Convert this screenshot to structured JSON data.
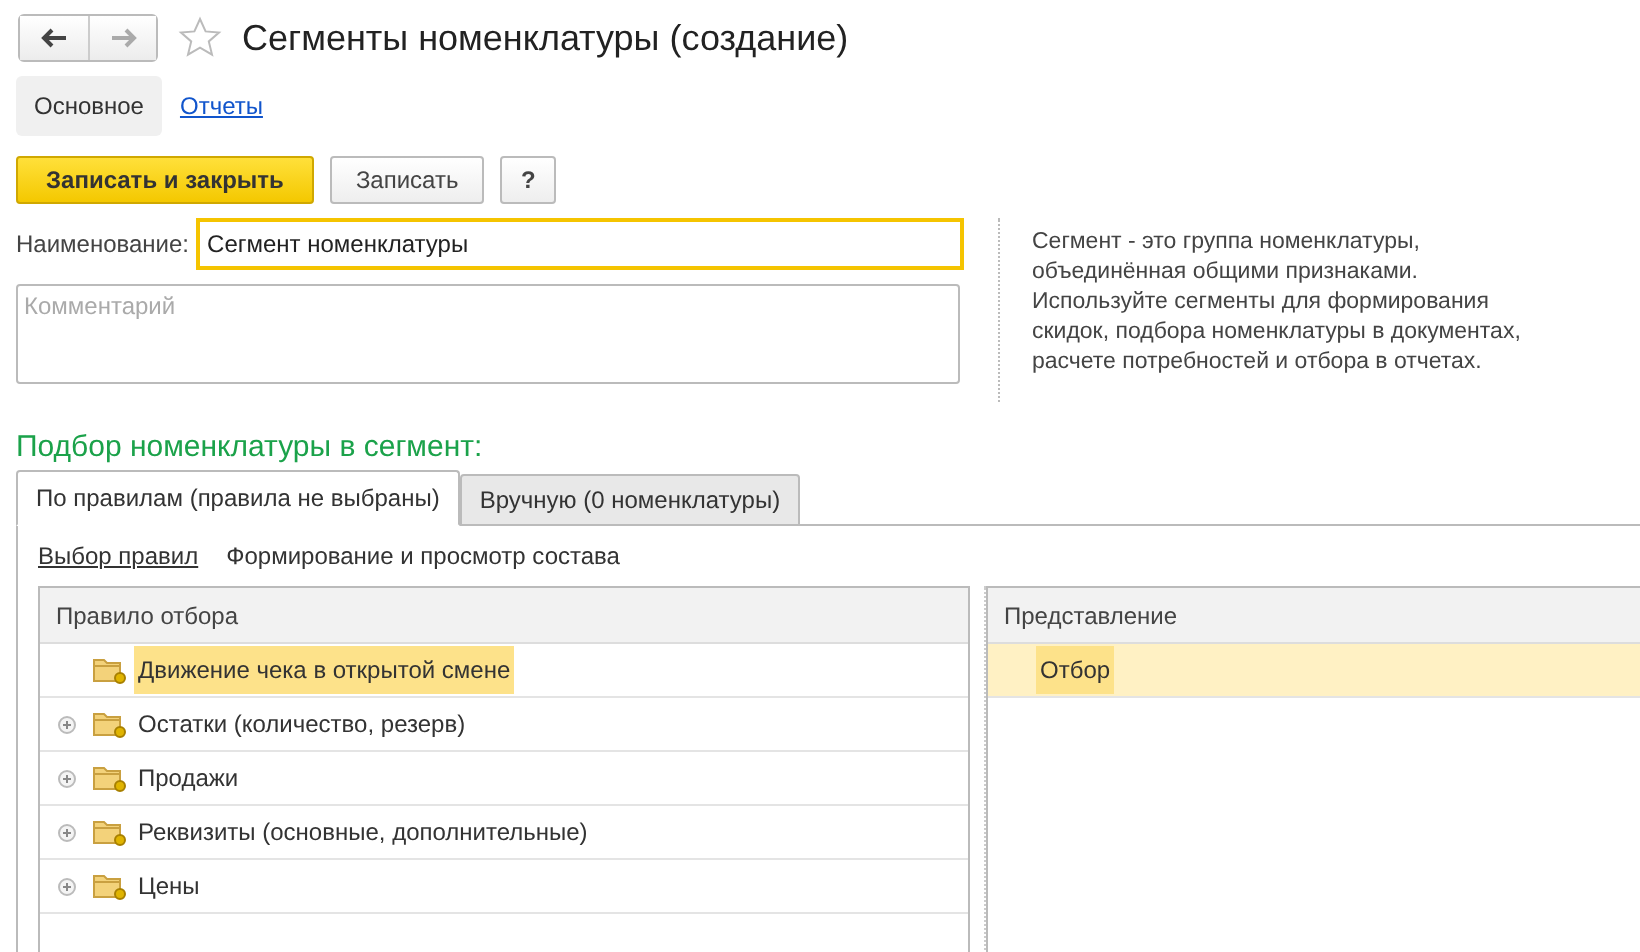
{
  "window": {
    "title": "Сегменты номенклатуры (создание)",
    "favorite": false
  },
  "sections": [
    {
      "label": "Основное",
      "selected": true
    },
    {
      "label": "Отчеты",
      "selected": false
    }
  ],
  "buttons": [
    {
      "label": "Записать и закрыть",
      "kind": "primary"
    },
    {
      "label": "Записать",
      "kind": "normal"
    },
    {
      "label": "?",
      "kind": "help"
    }
  ],
  "name_field": {
    "label": "Наименование:",
    "value": "Сегмент номенклатуры"
  },
  "comment_field": {
    "placeholder": "Комментарий"
  },
  "description": "Сегмент - это группа номенклатуры, объединённая общими признаками. Используйте сегменты для формирования скидок, подбора номенклатуры в документах, расчете потребностей и отбора в отчетах.",
  "selection_title": "Подбор номенклатуры в сегмент:",
  "tabs": [
    {
      "label": "По правилам (правила не выбраны)",
      "selected": true
    },
    {
      "label": "Вручную (0 номенклатуры)",
      "selected": false
    }
  ],
  "links": [
    {
      "label": "Выбор правил",
      "selected": true
    },
    {
      "label": "Формирование и просмотр состава",
      "selected": false
    }
  ],
  "rules_table": {
    "columns": [
      "Правило отбора"
    ],
    "rows": [
      {
        "label": "Движение чека в открытой смене",
        "kind": "leaf",
        "selected": true
      },
      {
        "label": "Остатки (количество, резерв)",
        "kind": "group",
        "selected": false
      },
      {
        "label": "Продажи",
        "kind": "group",
        "selected": false
      },
      {
        "label": "Реквизиты (основные, дополнительные)",
        "kind": "group",
        "selected": false
      },
      {
        "label": "Цены",
        "kind": "group",
        "selected": false
      }
    ]
  },
  "view_table": {
    "columns": [
      "Представление"
    ],
    "rows": [
      {
        "label": "Отбор",
        "selected": true
      }
    ]
  }
}
